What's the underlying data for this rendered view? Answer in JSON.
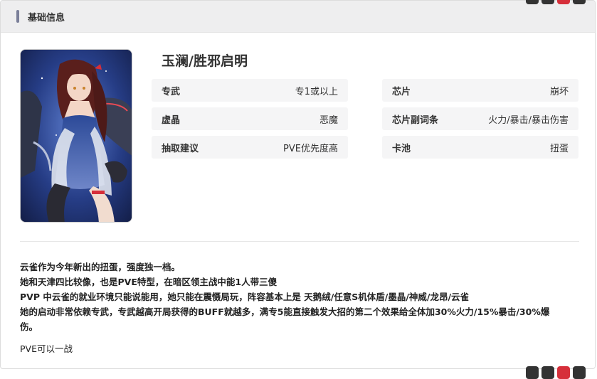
{
  "header": {
    "title": "基础信息"
  },
  "character": {
    "name": "玉澜/胜邪启明",
    "portrait_icon": "character-portrait"
  },
  "attributes": {
    "left": [
      {
        "key": "专武",
        "value": "专1或以上"
      },
      {
        "key": "虚晶",
        "value": "恶魔"
      },
      {
        "key": "抽取建议",
        "value": "PVE优先度高"
      }
    ],
    "right": [
      {
        "key": "芯片",
        "value": "崩坏"
      },
      {
        "key": "芯片副词条",
        "value": "火力/暴击/暴击伤害"
      },
      {
        "key": "卡池",
        "value": "扭蛋"
      }
    ]
  },
  "description": {
    "lines": [
      "云雀作为今年新出的扭蛋，强度独一档。",
      "她和天津四比较像，也是PVE特型，在暗区领主战中能1人带三傻",
      "PVP 中云雀的就业环境只能说能用，她只能在震慑局玩，阵容基本上是 天鹅绒/任意S机体盾/墨晶/神威/龙昂/云雀",
      "她的启动非常依赖专武，专武越高开局获得的BUFF就越多，满专5能直接触发大招的第二个效果给全体加30%火力/15%暴击/30%爆伤。"
    ],
    "footer": "PVE可以一战"
  },
  "colors": {
    "header_bg": "#eeeeef",
    "accent_bar": "#7a7f99",
    "attr_bg": "#f5f5f6",
    "corner_red": "#d62f3a"
  }
}
